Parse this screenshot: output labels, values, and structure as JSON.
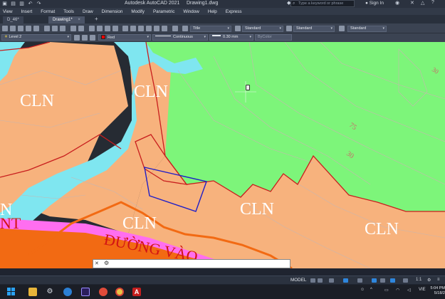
{
  "titlebar": {
    "app_title": "Autodesk AutoCAD 2021",
    "file_name": "Drawing1.dwg",
    "search_placeholder": "Type a keyword or phrase",
    "signin_label": "Sign In"
  },
  "menu": [
    "View",
    "Insert",
    "Format",
    "Tools",
    "Draw",
    "Dimension",
    "Modify",
    "Parametric",
    "Window",
    "Help",
    "Express"
  ],
  "tabs": [
    {
      "label": "D_46*"
    },
    {
      "label": "Drawing1*"
    }
  ],
  "toolbar": {
    "text_style": "Title",
    "dim_style": "Standard",
    "table_style": "Standard",
    "multileader_style": "Standard",
    "layer": "Level 2",
    "color": "Red",
    "linetype": "Continuous",
    "lineweight": "0.30 mm",
    "plot_style": "ByColor"
  },
  "drawing": {
    "labels": [
      "CLN",
      "CLN",
      "CLN",
      "CLN",
      "CLN",
      "N",
      "NT"
    ],
    "road_label": "ĐƯỜNG VÀO",
    "contour_labels": [
      "75",
      "30",
      "30"
    ],
    "colors": {
      "green_zone": "#7df57a",
      "orange_zone": "#f7b27d",
      "water": "#7fe6f0",
      "road_pink": "#ff6ef0",
      "road_orange": "#f26a13",
      "boundary": "#c81e1e",
      "selection": "#1e1ec8"
    }
  },
  "commandline": {
    "prompt": ""
  },
  "statusbar": {
    "model_label": "MODEL",
    "scale": "1:1"
  },
  "taskbar": {
    "language": "VIE",
    "time": "5:04 PM",
    "date": "5/18/2"
  }
}
